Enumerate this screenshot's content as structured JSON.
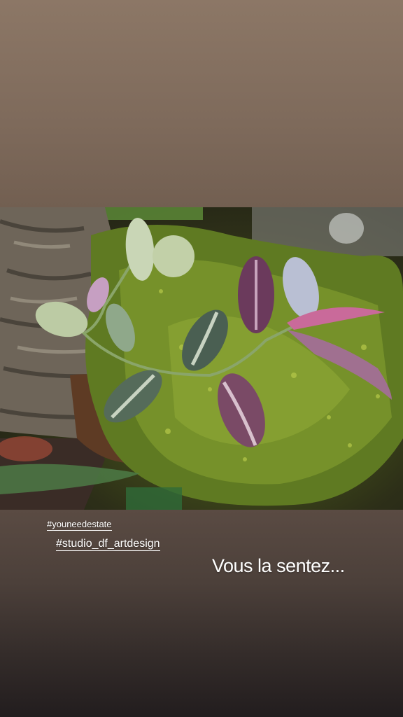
{
  "story": {
    "hashtags": [
      {
        "text": "#youneedestate"
      },
      {
        "text": "#studio_df_artdesign"
      }
    ],
    "caption": "Vous la sentez..."
  },
  "colors": {
    "top_background": "#8c7766",
    "bottom_background": "#231e1f",
    "text": "#ffffff",
    "moss": "#6f8a2a",
    "leaf_purple": "#6b3a5c",
    "leaf_green": "#b9c9a6"
  }
}
